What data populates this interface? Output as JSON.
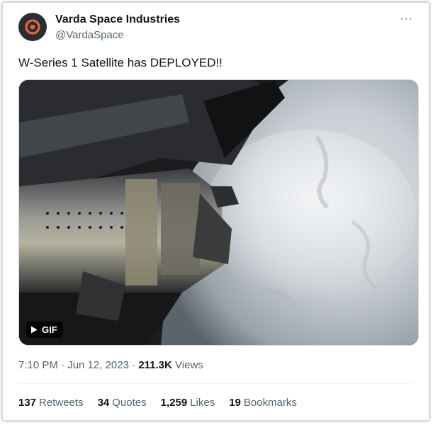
{
  "author": {
    "name": "Varda Space Industries",
    "handle": "@VardaSpace",
    "avatar_icon": "varda-logo-icon"
  },
  "more_icon": "more-horizontal-icon",
  "more_label": "···",
  "tweet": {
    "text": "W-Series 1 Satellite has DEPLOYED!!",
    "media": {
      "type": "gif",
      "badge_label": "GIF",
      "play_icon": "play-icon"
    },
    "time": "7:10 PM",
    "sep1": "·",
    "date": "Jun 12, 2023",
    "sep2": "·",
    "views_count": "211.3K",
    "views_label": "Views"
  },
  "stats": [
    {
      "count": "137",
      "label": "Retweets"
    },
    {
      "count": "34",
      "label": "Quotes"
    },
    {
      "count": "1,259",
      "label": "Likes"
    },
    {
      "count": "19",
      "label": "Bookmarks"
    }
  ],
  "colors": {
    "text_primary": "#0f1419",
    "text_secondary": "#536471",
    "border": "#cfd9de",
    "logo_accent": "#e8643c"
  }
}
